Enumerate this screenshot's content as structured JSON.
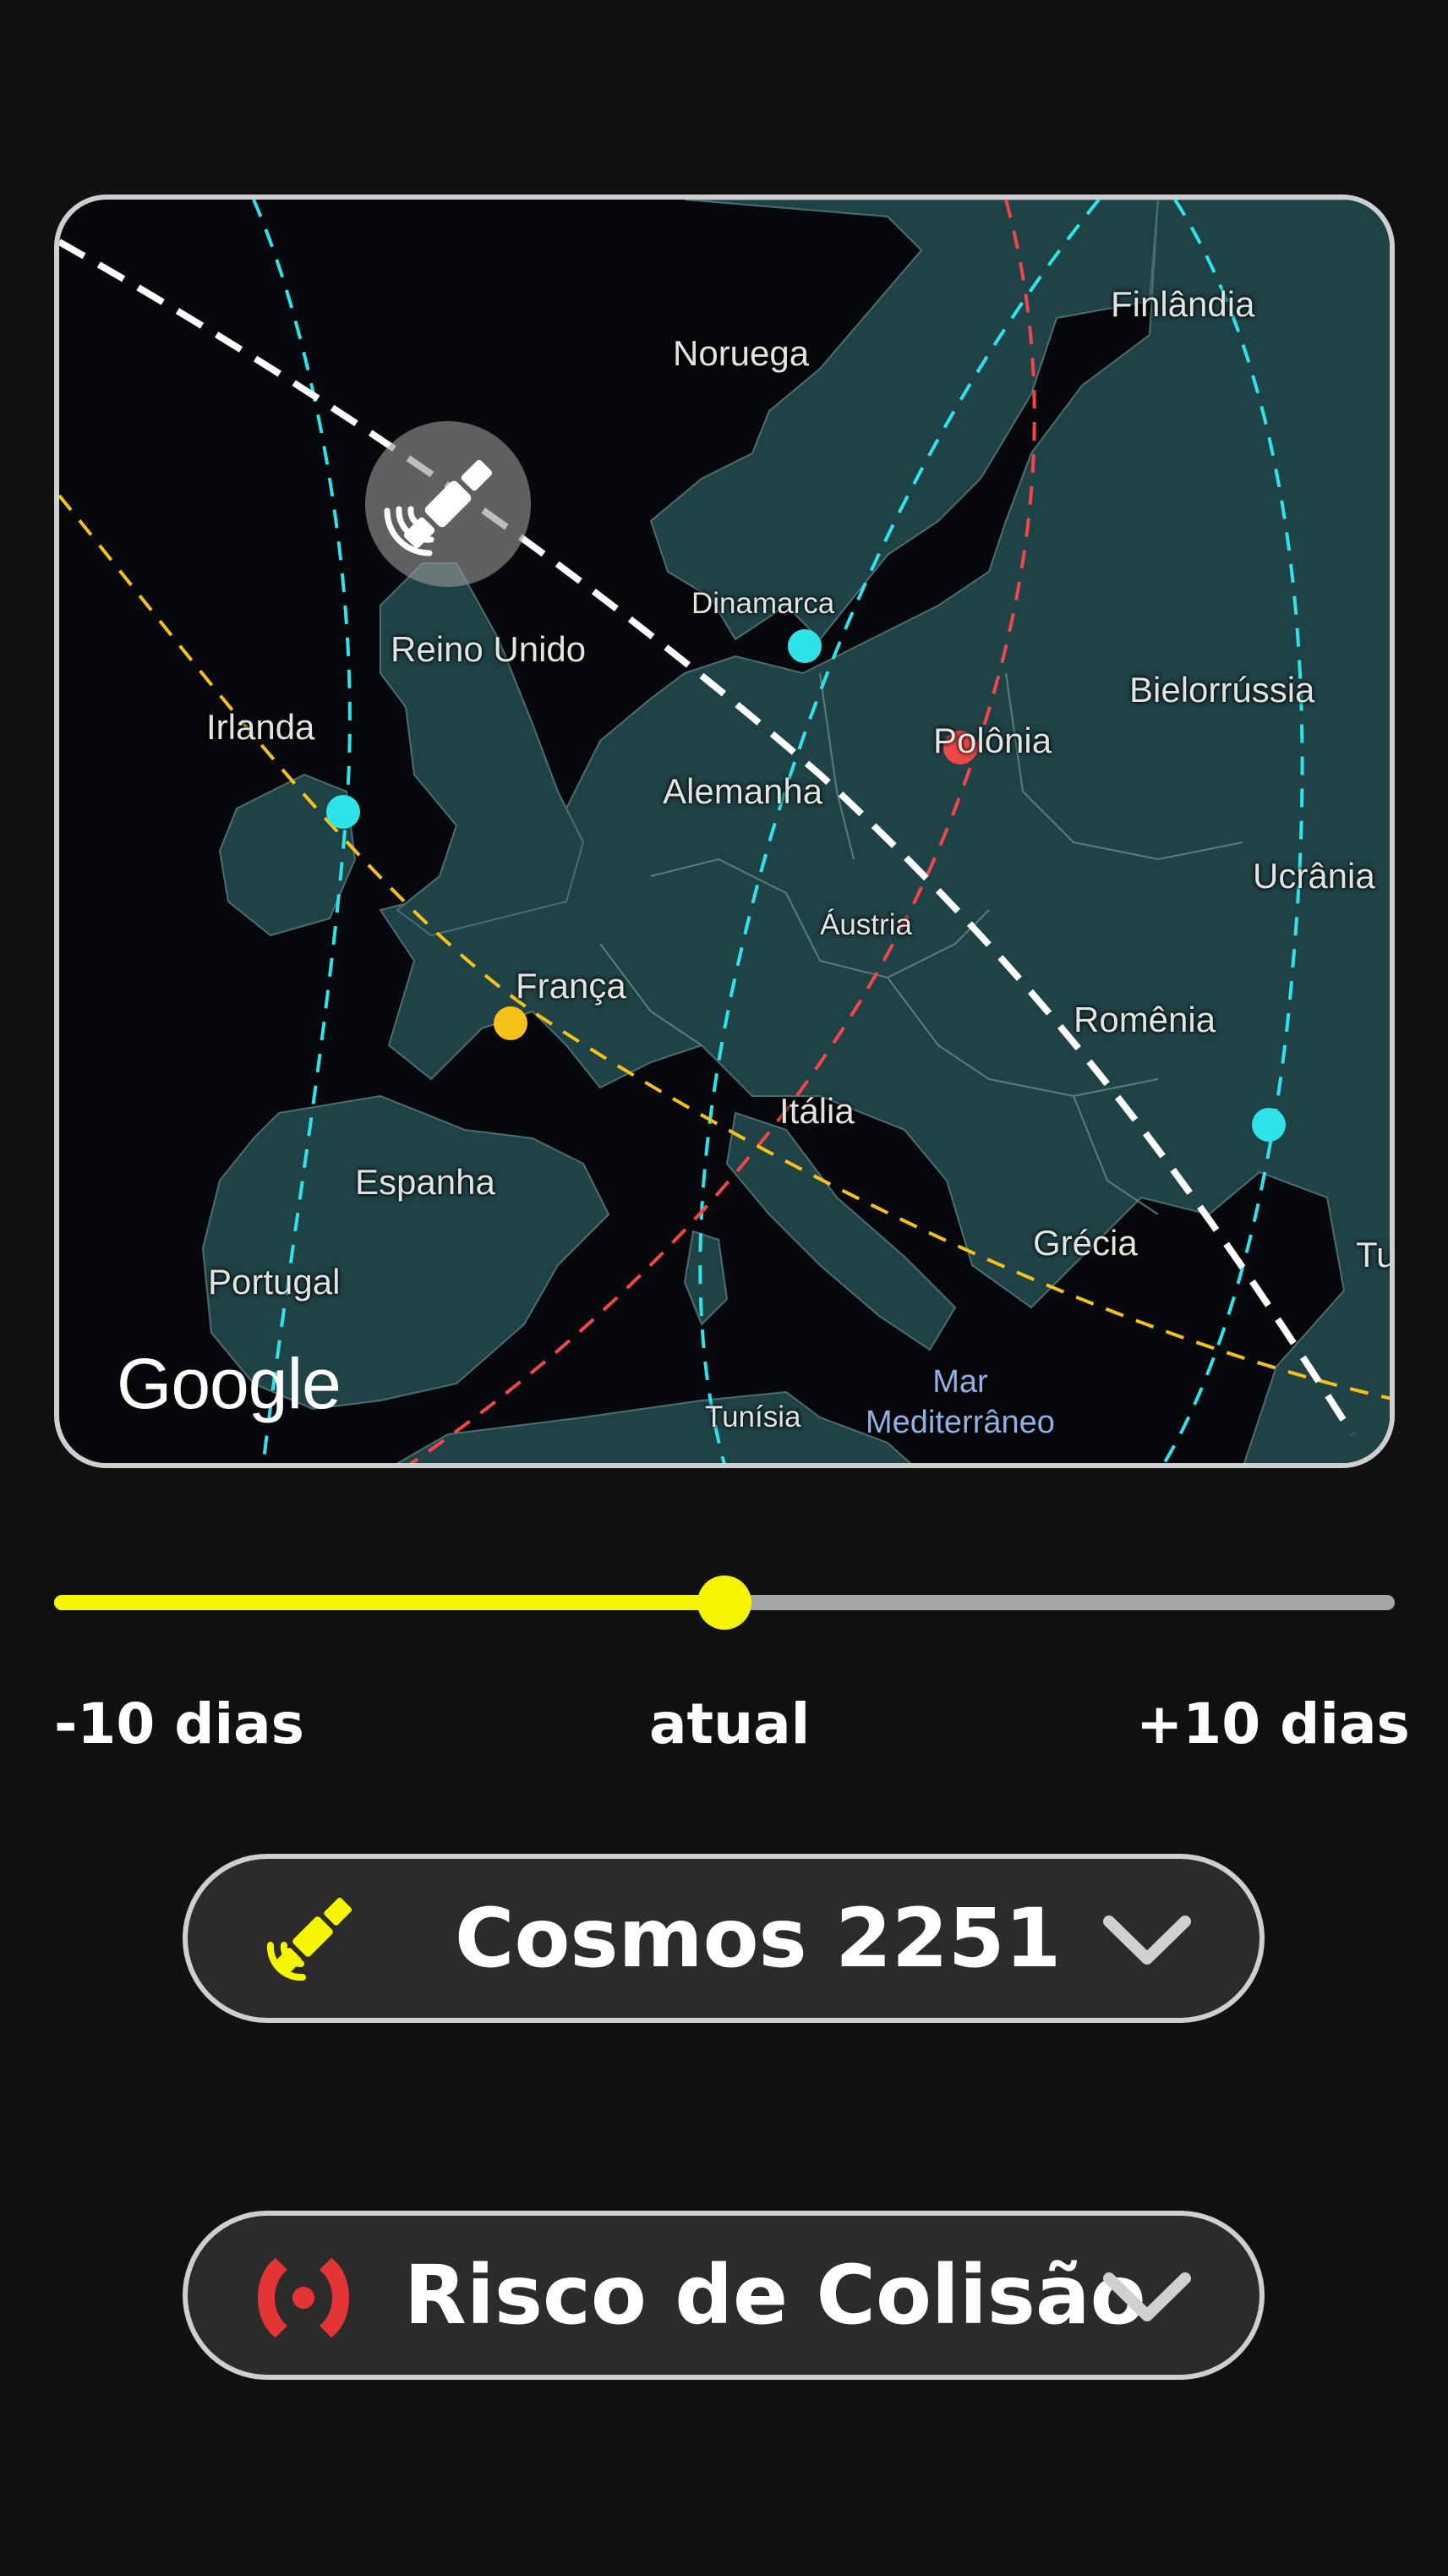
{
  "map": {
    "provider_logo": "Google",
    "places": {
      "noruega": "Noruega",
      "finlandia": "Finlândia",
      "dinamarca": "Dinamarca",
      "reino_unido": "Reino Unido",
      "irlanda": "Irlanda",
      "bielorrussia": "Bielorrússia",
      "polonia": "Polônia",
      "alemanha": "Alemanha",
      "ucrania": "Ucrânia",
      "austria": "Áustria",
      "franca": "França",
      "romenia": "Romênia",
      "italia": "Itália",
      "espanha": "Espanha",
      "grecia": "Grécia",
      "portugal": "Portugal",
      "turquia": "Tu",
      "tunisia": "Tunísia",
      "mar": "Mar",
      "mediterraneo": "Mediterrâneo"
    },
    "orbit_colors": {
      "selected": "#ffffff",
      "cyan": "#2fe3ea",
      "red": "#f04848",
      "yellow": "#f6c21a"
    },
    "selected_marker_icon": "satellite-icon"
  },
  "timeline": {
    "min_label": "-10 dias",
    "current_label": "atual",
    "max_label": "+10 dias",
    "position_fraction": 0.5,
    "active_color": "#f5f500",
    "inactive_color": "#a5a5a5"
  },
  "satellite_select": {
    "icon": "satellite-icon",
    "icon_color": "#f5f500",
    "label": "Cosmos 2251",
    "dropdown_icon": "chevron-down-icon"
  },
  "risk_select": {
    "icon": "collision-signal-icon",
    "icon_color": "#e33535",
    "label": "Risco de Colisão",
    "dropdown_icon": "chevron-down-icon"
  }
}
